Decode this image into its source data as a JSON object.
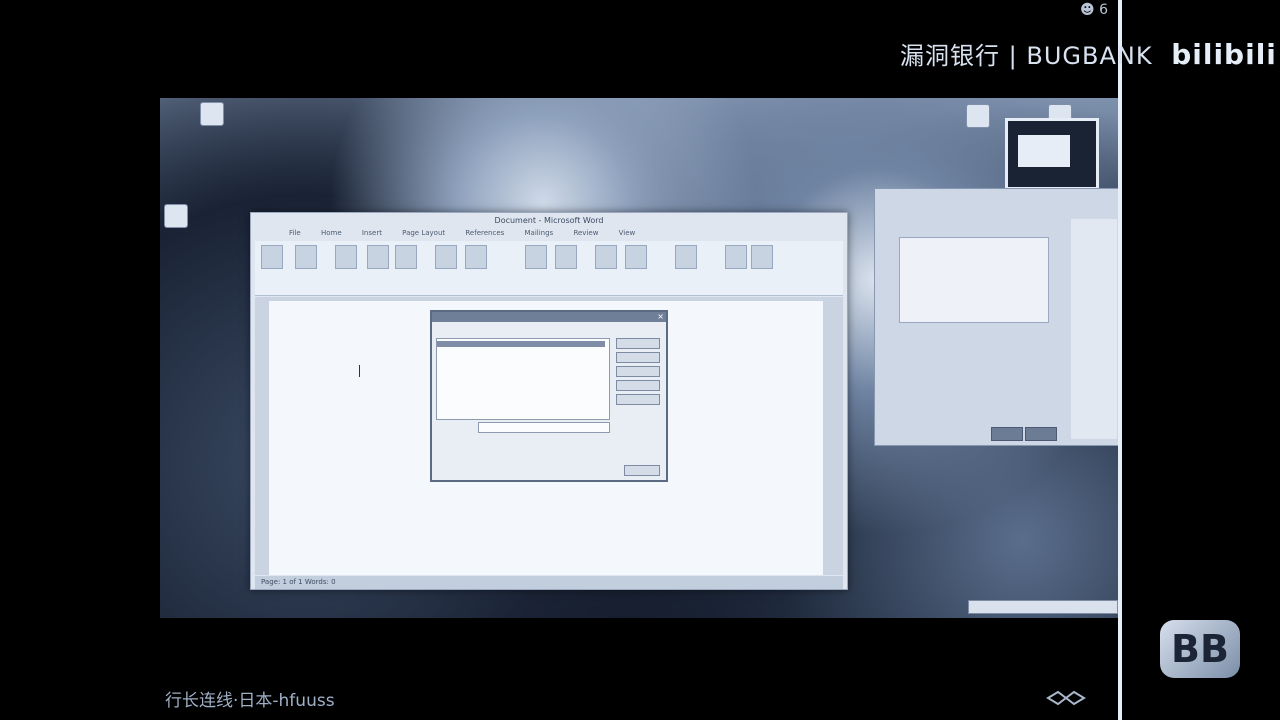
{
  "overlay": {
    "viewer_count": "6",
    "brand_cn": "漏洞银行",
    "brand_sep": "|",
    "brand_en": "BUGBANK",
    "brand_bili": "bilibili",
    "caption": "行长连线·日本-hfuuss",
    "bb_logo": "BB"
  },
  "desktop": {
    "word_window": {
      "title": "Document - Microsoft Word",
      "tabs": [
        "File",
        "Home",
        "Insert",
        "Page Layout",
        "References",
        "Mailings",
        "Review",
        "View"
      ],
      "status": "Page: 1 of 1   Words: 0"
    },
    "dialog": {
      "title": "",
      "close": "×",
      "list_label": "",
      "buttons": [
        "",
        "",
        "",
        "",
        ""
      ],
      "bottom_label": "",
      "combo_value": "",
      "cancel": ""
    },
    "right_app": {
      "title": ""
    },
    "taskbar_text": ""
  }
}
